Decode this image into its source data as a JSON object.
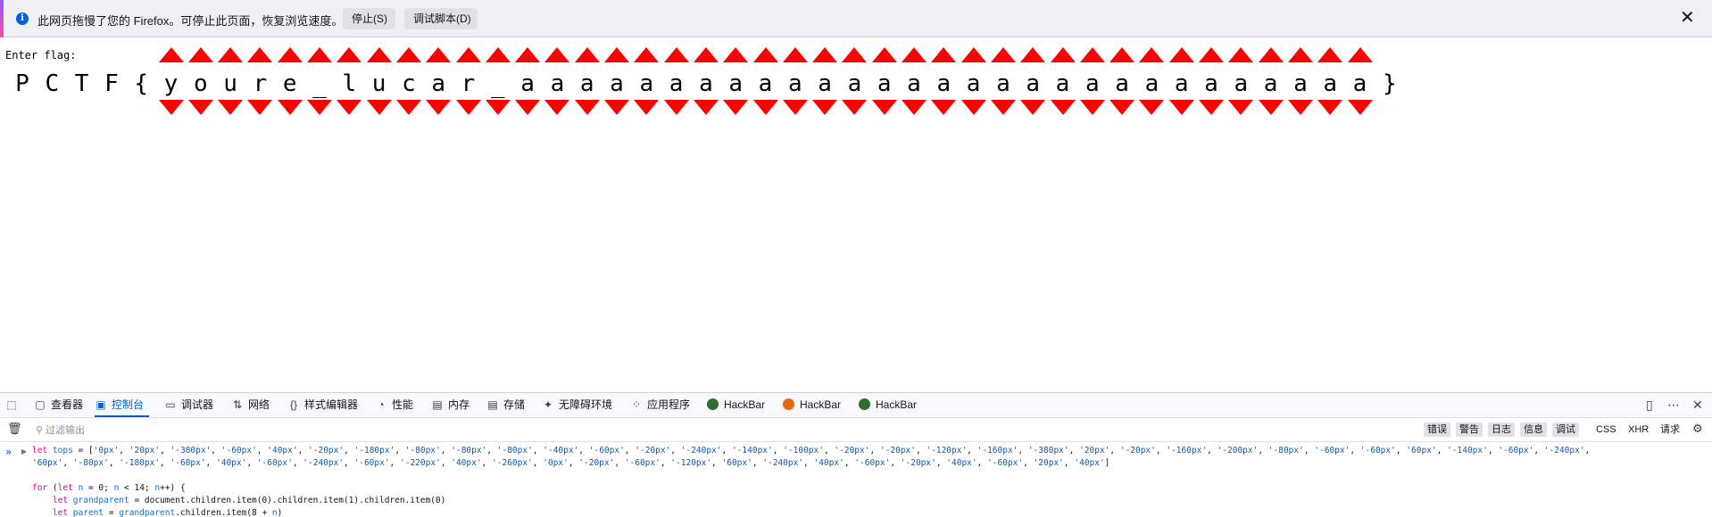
{
  "notification": {
    "message": "此网页拖慢了您的 Firefox。可停止此页面，恢复浏览速度。",
    "stop_button": "停止(S)",
    "debug_button": "调试脚本(D)"
  },
  "page": {
    "prompt": "Enter flag:",
    "flag_chars": [
      "P",
      "C",
      "T",
      "F",
      "{",
      "y",
      "o",
      "u",
      "r",
      "e",
      "_",
      "l",
      "u",
      "c",
      "a",
      "r",
      "_",
      "a",
      "a",
      "a",
      "a",
      "a",
      "a",
      "a",
      "a",
      "a",
      "a",
      "a",
      "a",
      "a",
      "a",
      "a",
      "a",
      "a",
      "a",
      "a",
      "a",
      "a",
      "a",
      "a",
      "a",
      "a",
      "a",
      "a",
      "a",
      "a",
      "}"
    ],
    "arrow_color": "#ff0000"
  },
  "devtools": {
    "tabs": [
      {
        "icon": "inspector-icon",
        "label": "查看器"
      },
      {
        "icon": "console-icon",
        "label": "控制台",
        "active": true
      },
      {
        "icon": "debugger-icon",
        "label": "调试器"
      },
      {
        "icon": "network-icon",
        "label": "网络"
      },
      {
        "icon": "style-editor-icon",
        "label": "样式编辑器"
      },
      {
        "icon": "performance-icon",
        "label": "性能"
      },
      {
        "icon": "memory-icon",
        "label": "内存"
      },
      {
        "icon": "storage-icon",
        "label": "存储"
      },
      {
        "icon": "accessibility-icon",
        "label": "无障碍环境"
      },
      {
        "icon": "application-icon",
        "label": "应用程序"
      },
      {
        "icon": "hackbar-icon",
        "label": "HackBar"
      },
      {
        "icon": "firefox-icon",
        "label": "HackBar"
      },
      {
        "icon": "hackbar-icon",
        "label": "HackBar"
      }
    ],
    "filter_placeholder": "过滤输出",
    "levels": [
      "错误",
      "警告",
      "日志",
      "信息",
      "调试"
    ],
    "extra_filters": [
      "CSS",
      "XHR",
      "请求"
    ],
    "console_code": [
      "let tops = ['0px', '20px', '-380px', '-60px', '40px', '-20px', '-180px', '-80px', '-80px', '-80px', '-40px', '-60px', '-20px', '-240px', '-140px', '-100px', '-20px', '-20px', '-120px', '-160px', '-380px', '20px', '-20px', '-160px', '-200px', '-80px', '-60px', '-60px', '60px', '-140px', '-60px', '-240px',",
      "'60px', '-80px', '-180px', '-60px', '40px', '-60px', '-240px', '-60px', '-220px', '40px', '-260px', '0px', '-20px', '-60px', '-120px', '60px', '-240px', '40px', '-60px', '-20px', '40px', '-60px', '20px', '40px']",
      "",
      "for (let n = 0; n < 14; n++) {",
      "    let grandparent = document.children.item(0).children.item(1).children.item(0)",
      "    let parent = grandparent.children.item(8 + n)"
    ]
  }
}
